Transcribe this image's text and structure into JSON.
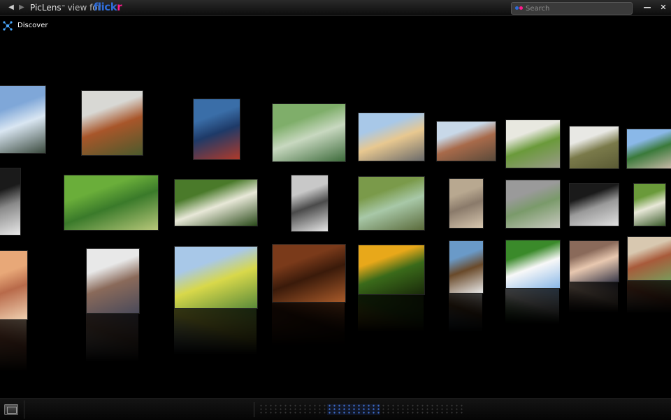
{
  "app": {
    "brand_name": "PicLens",
    "trademark": "™",
    "view_for": "view for",
    "flickr_part1": "flick",
    "flickr_part2": "r"
  },
  "titlebar": {
    "back_glyph": "◀",
    "forward_glyph": "▶",
    "minimize_glyph": "—",
    "close_glyph": "✕"
  },
  "search": {
    "placeholder": "Search",
    "icon": "flickr-dots-icon"
  },
  "discover": {
    "label": "Discover",
    "icon": "discover-icon"
  },
  "colors": {
    "flickr_blue": "#2f6cd7",
    "flickr_pink": "#ff1b8d",
    "background": "#000000",
    "scrubber_active": "#3f6fcf"
  },
  "photos": [
    {
      "id": "sky-landscape",
      "colors": [
        "#7fa7d8",
        "#d9e6f2",
        "#3b4a3e"
      ]
    },
    {
      "id": "autumn-tree",
      "colors": [
        "#d8d8d4",
        "#a8562a",
        "#4b5a2c"
      ]
    },
    {
      "id": "car-trunk",
      "colors": [
        "#3a6ea8",
        "#1e3a68",
        "#b03a2a"
      ]
    },
    {
      "id": "leaf-macro",
      "colors": [
        "#7fae6a",
        "#c8d8c0",
        "#3c6a3a"
      ]
    },
    {
      "id": "people-bridge",
      "colors": [
        "#a8c8e8",
        "#e8c890",
        "#6a6a6a"
      ]
    },
    {
      "id": "lying-person",
      "colors": [
        "#c8d8e8",
        "#a86a4a",
        "#5a4a3a"
      ]
    },
    {
      "id": "potted-plant",
      "colors": [
        "#e8e8e0",
        "#6a9a3a",
        "#9a9a8a"
      ]
    },
    {
      "id": "light-icon-tile",
      "colors": [
        "#e8e8e4",
        "#7a7a4a",
        "#5a5a34"
      ]
    },
    {
      "id": "green-tree-house",
      "colors": [
        "#8ab8e8",
        "#3a7a3a",
        "#c8b8a8"
      ]
    },
    {
      "id": "shoes-bw",
      "colors": [
        "#1a1a1a",
        "#8a8a8a",
        "#e8e8e8"
      ]
    },
    {
      "id": "grass-field",
      "colors": [
        "#6aae3a",
        "#3a7a2a",
        "#b8c87a"
      ]
    },
    {
      "id": "dandelion",
      "colors": [
        "#4a7a2a",
        "#e8e8d8",
        "#2a4a1a"
      ]
    },
    {
      "id": "building-bw",
      "colors": [
        "#c8c8c8",
        "#4a4a4a",
        "#e8e8e8"
      ]
    },
    {
      "id": "child-meadow",
      "colors": [
        "#7a9a4a",
        "#a8c8a8",
        "#5a6a3a"
      ]
    },
    {
      "id": "stone-carving",
      "colors": [
        "#b8a890",
        "#8a7a6a",
        "#d8c8b0"
      ]
    },
    {
      "id": "fountain-garden",
      "colors": [
        "#9a9a9a",
        "#7a9a6a",
        "#c8c8c0"
      ]
    },
    {
      "id": "iron-gate-bw",
      "colors": [
        "#1a1a1a",
        "#9a9a9a",
        "#e0e0e0"
      ]
    },
    {
      "id": "white-flower",
      "colors": [
        "#6a9a3a",
        "#e8e8d8",
        "#3a5a2a"
      ]
    },
    {
      "id": "face-closeup",
      "colors": [
        "#e8a878",
        "#b86a4a",
        "#f0d0b0"
      ]
    },
    {
      "id": "desk-papers",
      "colors": [
        "#e8e8e8",
        "#8a6a5a",
        "#4a4a5a"
      ]
    },
    {
      "id": "meadow-trees",
      "colors": [
        "#a8c8e8",
        "#d8d84a",
        "#5a8a3a"
      ]
    },
    {
      "id": "dark-orange-texture",
      "colors": [
        "#7a3a1a",
        "#3a1a0a",
        "#a85a2a"
      ]
    },
    {
      "id": "yellow-flowers",
      "colors": [
        "#e8a81a",
        "#3a6a1a",
        "#1a2a0a"
      ]
    },
    {
      "id": "wooden-tower",
      "colors": [
        "#6a9ac8",
        "#6a4a2a",
        "#e8e8e8"
      ]
    },
    {
      "id": "golf-ball",
      "colors": [
        "#3a8a2a",
        "#f8f8f8",
        "#8ab8e8"
      ]
    },
    {
      "id": "couple-couch",
      "colors": [
        "#8a6a5a",
        "#e8c8b0",
        "#3a3a4a"
      ]
    },
    {
      "id": "dog-house",
      "colors": [
        "#d8c8b0",
        "#a85a3a",
        "#7a9a5a"
      ]
    }
  ],
  "bottombar": {
    "thumb_toggle_icon": "thumbnail-toggle-icon"
  }
}
